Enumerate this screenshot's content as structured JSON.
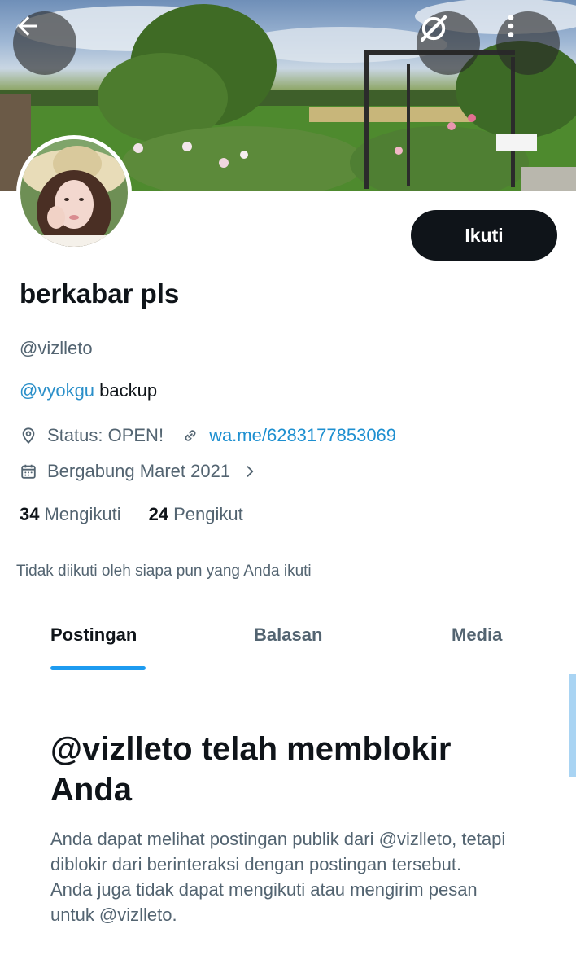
{
  "header": {
    "back_icon": "arrow-left-icon",
    "grok_icon": "grok-icon",
    "more_icon": "more-vertical-icon"
  },
  "profile": {
    "follow_label": "Ikuti",
    "display_name": "berkabar pls",
    "handle": "@vizlleto",
    "bio_mention": "@vyokgu",
    "bio_rest": " backup",
    "location": "Status: OPEN!",
    "website": "wa.me/6283177853069",
    "joined": "Bergabung Maret 2021",
    "following_count": "34",
    "following_label": "Mengikuti",
    "followers_count": "24",
    "followers_label": "Pengikut",
    "not_followed_note": "Tidak diikuti oleh siapa pun yang Anda ikuti"
  },
  "tabs": [
    {
      "label": "Postingan",
      "active": true
    },
    {
      "label": "Balasan",
      "active": false
    },
    {
      "label": "Media",
      "active": false
    }
  ],
  "blocked": {
    "title": "@vizlleto telah memblokir Anda",
    "message": "Anda dapat melihat postingan publik dari @vizlleto, tetapi diblokir dari berinteraksi dengan postingan tersebut. Anda juga tidak dapat mengikuti atau mengirim pesan untuk @vizlleto."
  },
  "colors": {
    "accent": "#1d9bf0",
    "primary_text": "#0f1419",
    "secondary_text": "#536471"
  }
}
